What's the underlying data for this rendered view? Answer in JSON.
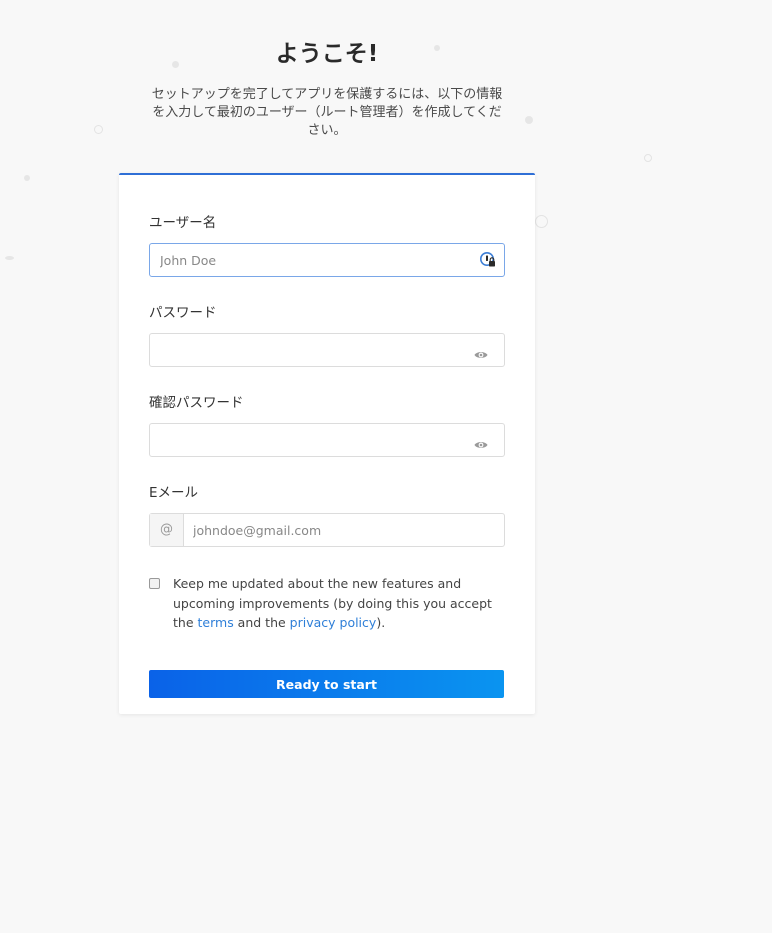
{
  "header": {
    "title": "ようこそ!",
    "subtitle": "セットアップを完了してアプリを保護するには、以下の情報を入力して最初のユーザー（ルート管理者）を作成してください。"
  },
  "form": {
    "username": {
      "label": "ユーザー名",
      "placeholder": "John Doe",
      "value": "",
      "icon": "password-manager-icon"
    },
    "password": {
      "label": "パスワード",
      "value": "",
      "icon": "eye-icon"
    },
    "confirm_password": {
      "label": "確認パスワード",
      "value": "",
      "icon": "eye-icon"
    },
    "email": {
      "label": "Eメール",
      "prefix": "@",
      "placeholder": "johndoe@gmail.com",
      "value": ""
    },
    "newsletter": {
      "checked": false,
      "text_before": "Keep me updated about the new features and upcoming improvements (by doing this you accept the ",
      "terms_link": "terms",
      "text_middle": " and the ",
      "privacy_link": "privacy policy",
      "text_after": ")."
    },
    "submit_label": "Ready to start"
  },
  "colors": {
    "accent": "#2f6fd6",
    "button_start": "#0a62e8",
    "button_end": "#0a94f0",
    "link": "#2f7fd8",
    "background": "#f8f8f8"
  }
}
